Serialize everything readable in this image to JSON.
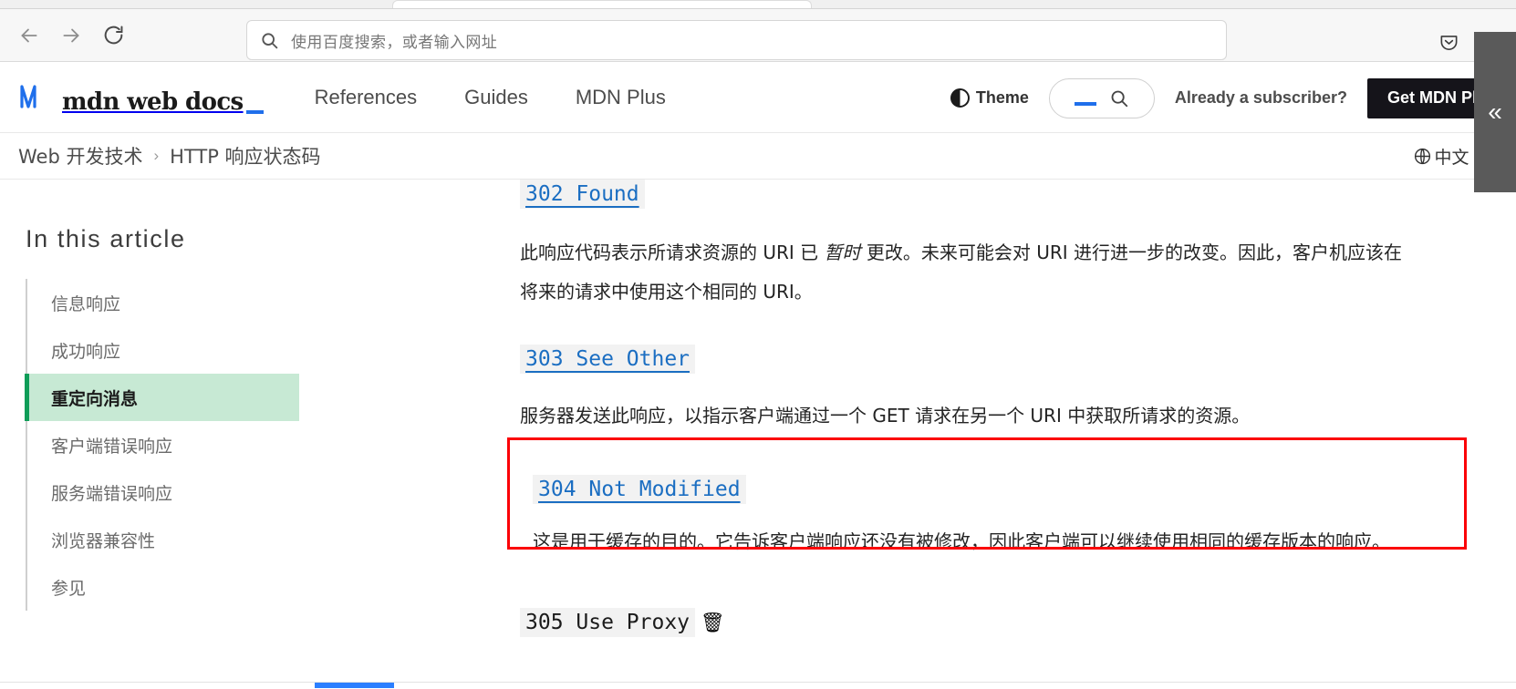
{
  "browser": {
    "back_icon": "arrow-left-icon",
    "forward_icon": "arrow-right-icon",
    "reload_icon": "reload-icon",
    "url_placeholder": "使用百度搜索，或者输入网址",
    "search_icon": "search-icon",
    "pocket_icon": "pocket-icon",
    "minimize_icon": "minimize-icon"
  },
  "mdn_header": {
    "logo_text": "mdn web docs",
    "logo_mark": "mdn-m-logo-icon",
    "nav": [
      {
        "label": "References"
      },
      {
        "label": "Guides"
      },
      {
        "label": "MDN Plus"
      }
    ],
    "theme_label": "Theme",
    "theme_icon": "half-circle-theme-icon",
    "search_icon": "search-icon",
    "subscriber_text": "Already a subscriber?",
    "get_plus_label": "Get MDN Plus"
  },
  "breadcrumb": {
    "items": [
      {
        "label": "Web 开发技术"
      },
      {
        "label": "HTTP 响应状态码"
      }
    ],
    "separator": "›",
    "language": {
      "globe_icon": "globe-icon",
      "label": "中文 (简体"
    }
  },
  "toc": {
    "title": "In this article",
    "items": [
      {
        "label": "信息响应",
        "active": false
      },
      {
        "label": "成功响应",
        "active": false
      },
      {
        "label": "重定向消息",
        "active": true
      },
      {
        "label": "客户端错误响应",
        "active": false
      },
      {
        "label": "服务端错误响应",
        "active": false
      },
      {
        "label": "浏览器兼容性",
        "active": false
      },
      {
        "label": "参见",
        "active": false
      }
    ]
  },
  "article": {
    "sections": [
      {
        "heading": "302 Found",
        "paragraph_prefix": "此响应代码表示所请求资源的 URI 已 ",
        "paragraph_em": "暂时",
        "paragraph_suffix": " 更改。未来可能会对 URI 进行进一步的改变。因此，客户机应该在将来的请求中使用这个相同的 URI。"
      },
      {
        "heading": "303 See Other",
        "paragraph": "服务器发送此响应，以指示客户端通过一个 GET 请求在另一个 URI 中获取所请求的资源。"
      },
      {
        "heading": "304 Not Modified",
        "paragraph": "这是用于缓存的目的。它告诉客户端响应还没有被修改，因此客户端可以继续使用相同的缓存版本的响应。",
        "highlight_color": "#fb0007"
      },
      {
        "heading": "305 Use Proxy",
        "deprecated_icon": "trash-icon",
        "deprecated_glyph": "🗑"
      }
    ]
  },
  "side_panel": {
    "collapse_icon": "chevron-double-left-icon",
    "collapse_glyph": "«"
  },
  "colors": {
    "accent_blue": "#1f6feb",
    "link_blue": "#1b6ec2",
    "active_toc_bg": "#c7e9d4",
    "active_toc_border": "#0f9d58",
    "highlight_red": "#fb0007",
    "scrollbar_blue": "#2b7fff"
  }
}
